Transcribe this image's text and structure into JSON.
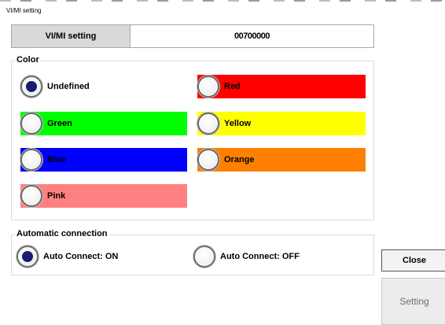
{
  "window": {
    "title": "VI/MI setting"
  },
  "header": {
    "label": "VI/MI setting",
    "value": "00700000"
  },
  "color_group": {
    "title": "Color",
    "options": [
      {
        "label": "Undefined",
        "color": "#ffffff",
        "selected": true
      },
      {
        "label": "Red",
        "color": "#ff0000",
        "selected": false
      },
      {
        "label": "Green",
        "color": "#00ff00",
        "selected": false
      },
      {
        "label": "Yellow",
        "color": "#ffff00",
        "selected": false
      },
      {
        "label": "Blue",
        "color": "#0000ff",
        "selected": false
      },
      {
        "label": "Orange",
        "color": "#ff8000",
        "selected": false
      },
      {
        "label": "Pink",
        "color": "#ff8080",
        "selected": false
      }
    ]
  },
  "auto_group": {
    "title": "Automatic connection",
    "options": [
      {
        "label": "Auto Connect: ON",
        "selected": true
      },
      {
        "label": "Auto Connect: OFF",
        "selected": false
      }
    ]
  },
  "buttons": {
    "close": "Close",
    "setting": "Setting"
  }
}
